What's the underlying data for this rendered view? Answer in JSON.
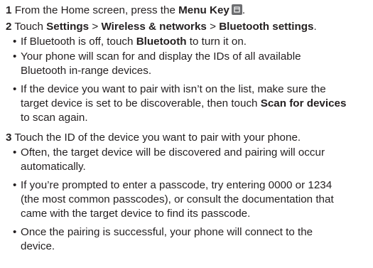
{
  "step1": {
    "number": "1",
    "text_before": "From the Home screen, press the",
    "key_label": "Menu Key",
    "text_after": ".",
    "icon": "menu-key-icon"
  },
  "step2": {
    "number": "2",
    "text_touch": "Touch",
    "settings": "Settings",
    "sep1": ">",
    "wireless": "Wireless & networks",
    "sep2": ">",
    "bluetooth_settings": "Bluetooth settings",
    "end": ".",
    "bullets": {
      "b1_before": "If Bluetooth is off, touch",
      "b1_bold": "Bluetooth",
      "b1_after": "to turn it on.",
      "b2_line1": "Your phone will scan for and display the IDs of all available",
      "b2_line2": "Bluetooth in-range devices.",
      "b3_line1": "If the device you want to pair with isn’t on the list, make sure the",
      "b3_line2_before": "target device is set to be discoverable, then touch",
      "b3_line2_bold": "Scan for devices",
      "b3_line3": "to scan again."
    }
  },
  "step3": {
    "number": "3",
    "text": "Touch the ID of the device you want to pair with your phone.",
    "bullets": {
      "b1_line1": "Often, the target device will be discovered and pairing will occur",
      "b1_line2": "automatically.",
      "b2_line1": "If you’re prompted to enter a passcode, try entering 0000 or 1234",
      "b2_line2": "(the most common passcodes), or consult the documentation that",
      "b2_line3": "came with the target device to find its passcode.",
      "b3_line1": "Once the pairing is successful, your phone will connect to the",
      "b3_line2": "device."
    }
  },
  "bullet_char": "•"
}
